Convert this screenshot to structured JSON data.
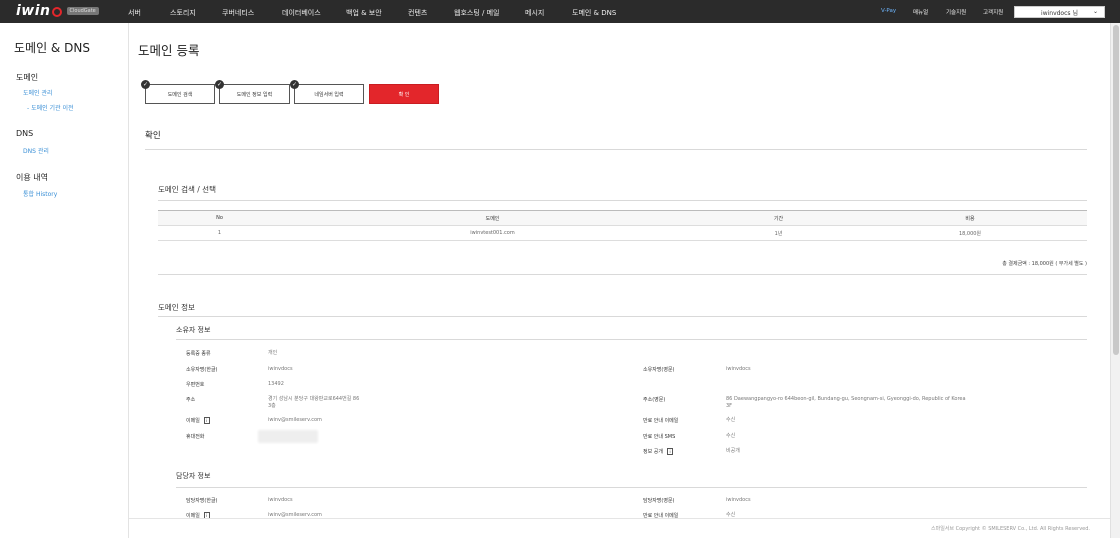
{
  "brand": {
    "logo": "iwin",
    "badge": "CloudGate"
  },
  "nav": {
    "items": [
      "서버",
      "스토리지",
      "쿠버네티스",
      "데이터베이스",
      "백업 & 보안",
      "컨텐츠",
      "웹호스팅 / 메일",
      "메시지",
      "도메인 & DNS"
    ],
    "right": [
      "V-Pay",
      "매뉴얼",
      "기술지원",
      "고객지원"
    ],
    "user": "iwinvdocs 님"
  },
  "sidebar": {
    "title": "도메인 & DNS",
    "groups": [
      {
        "label": "도메인",
        "links": [
          "도메인 관리",
          "- 도메인 기관 이전"
        ]
      },
      {
        "label": "DNS",
        "links": [
          "DNS 관리"
        ]
      },
      {
        "label": "이용 내역",
        "links": [
          "통합 History"
        ]
      }
    ]
  },
  "page": {
    "title": "도메인 등록",
    "steps": [
      "도메인 검색",
      "도메인 정보 입력",
      "네임서버 입력",
      "확 인"
    ],
    "confirm_title": "확인"
  },
  "summary": {
    "title": "도메인 검색 / 선택",
    "headers": [
      "No",
      "도메인",
      "기간",
      "비용"
    ],
    "rows": [
      [
        "1",
        "iwinvtest001.com",
        "1년",
        "18,000원"
      ]
    ],
    "total": "총 결제금액 : 18,000원 ( 부가세 별도 )"
  },
  "domain_info": {
    "title": "도메인 정보",
    "owner": {
      "title": "소유자 정보",
      "reg_type_label": "등록증 종류",
      "reg_type": "개인",
      "name_kr_label": "소유자명(한글)",
      "name_kr": "iwinvdocs",
      "name_en_label": "소유자명(영문)",
      "name_en": "iwinvdocs",
      "zip_label": "우편번호",
      "zip": "13492",
      "addr_label": "주소",
      "addr_line1": "경기 성남시 분당구 대왕판교로644번길 86",
      "addr_line2": "3층",
      "addr_en_label": "주소(영문)",
      "addr_en_line1": "86 Daewangpangyo-ro 644beon-gil, Bundang-gu, Seongnam-si, Gyeonggi-do, Republic of Korea",
      "addr_en_line2": "3F",
      "email_label": "이메일",
      "email": "iwinv@smileserv.com",
      "expire_email_label": "만료 안내 이메일",
      "expire_email": "수신",
      "phone_label": "휴대전화",
      "expire_sms_label": "만료 안내 SMS",
      "expire_sms": "수신",
      "privacy_label": "정보 공개",
      "privacy": "비공개"
    },
    "manager": {
      "title": "담당자 정보",
      "name_kr_label": "담당자명(한글)",
      "name_kr": "iwinvdocs",
      "name_en_label": "담당자명(영문)",
      "name_en": "iwinvdocs",
      "email_label": "이메일",
      "email": "iwinv@smileserv.com",
      "expire_email_label": "만료 안내 이메일",
      "expire_email": "수신"
    }
  },
  "footer": "스마일서브 Copyright © SMILESERV Co., Ltd. All Rights Reserved.",
  "colors": {
    "nav_bg": "#2b2b2b",
    "accent_red": "#e3262b",
    "link_blue": "#3a8fd6"
  }
}
